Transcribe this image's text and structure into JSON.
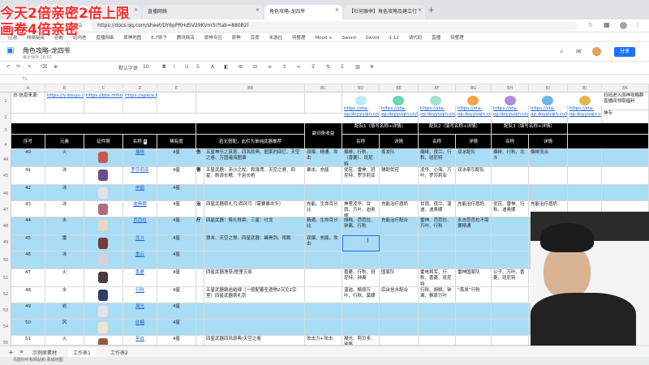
{
  "browser": {
    "tabs": [
      {
        "label": "…gaming",
        "active": false
      },
      {
        "label": "直播网络",
        "active": false
      },
      {
        "label": "角色攻略-龙四爷",
        "active": true
      },
      {
        "label": "【社何猴举】角色攻略及建立行",
        "active": false
      }
    ],
    "url": "https://docs.qq.com/sheet/DY6pPRHdSV29KVm5I?tab=880B2l",
    "bookmarks": [
      "应用",
      "网络链接",
      "谷歌",
      "站内信",
      "直播网络",
      "原神地图",
      "8.7原子",
      "腾讯商店",
      "原神专区",
      "原神",
      "百度",
      "米游社",
      "待整理",
      "Mood ×",
      "Sword",
      "Sword",
      "1.12",
      "请代码",
      "直播",
      "待整理"
    ]
  },
  "header": {
    "doc_title": "角色攻略-龙四爷",
    "doc_sub": "最近保存 16:02",
    "share": "分享"
  },
  "toolbar": {
    "font": "默认字体",
    "size": "10",
    "bold": "B"
  },
  "columns": [
    "A",
    "B",
    "C",
    "D",
    "E",
    "BB",
    "BC",
    "BD",
    "BE",
    "BF",
    "BG",
    "BH",
    "BI",
    "BJ",
    "BK"
  ],
  "rows": [
    "1",
    "2",
    "3",
    "4",
    "44",
    "45",
    "46",
    "47",
    "48",
    "49",
    "50",
    "51",
    "52",
    "53",
    "54",
    "55"
  ],
  "top": {
    "a1": "总-信息来源:",
    "b1": "https://v.douyu.com/author/yBRbxVvvzdZ4",
    "c1": "https://bbs.mihoyo.com/ys/collection/577792",
    "d1": "https://space.bilibili.com/307353814",
    "bd_links": [
      "https://sta-op.doyyuqin.cn/butter",
      "https://sta-op.doyyuqin.cn/butter",
      "https://sta-op.doyyuqin.cn/butter",
      "https://sta-op.doyyuqin.cn/butter",
      "https://sta-op.doyyuqin.cn/butter",
      "https://sta-op.doyyuqin.cn/butter",
      "https://sta-op.doyyuqin.cn/butter"
    ],
    "bk1": "扫码进入原神攻略群直播间领取福利",
    "bk2": "神专"
  },
  "headers": {
    "seq": "序号",
    "element": "元素",
    "portrait": "证件照",
    "name": "名称",
    "rarity": "稀有度",
    "weapon_note": "若无搭配，此栏为单纯武器推荐",
    "sub": "副词条收益",
    "team1": "配队1（填写名称+详情）",
    "team2": "配队2（填写名称+详情）",
    "team3": "配队3（填写名称+详情）",
    "col_name": "名称",
    "col_detail": "详情"
  },
  "rows_data": [
    {
      "row": "44",
      "seq": "40",
      "el": "火",
      "name": "烟绯",
      "rar": "4星",
      "side": "伤",
      "weapon": "五星神乐之真意、四风原典、图莱的回忆、天空之卷、万国诸海图谱",
      "sub": "双爆、精通、攻击",
      "t1n": "烟绯、行秋、（香菱）、班尼特",
      "t1d": "蒸发队",
      "t2n": "烟绯、夜兰、行秋、班尼特",
      "t2d": "双冰配队",
      "t3n": "烟绯、行秋、北斗",
      "t3d": "烟绯流派",
      "color": "blue"
    },
    {
      "row": "45",
      "seq": "41",
      "el": "冰",
      "name": "罗莎莉亚",
      "rar": "4星",
      "side": "害",
      "weapon": "五星武器：赤沙之杖、和璞鸢、天空之脊、四星：断浪长鳍、千岩长枪",
      "sub": "暴击、充能",
      "t1n": "优菈、雷神、班尼特、罗莎莉亚",
      "t1d": "辅助优菈",
      "t2n": "凌华、心海、万叶、罗莎莉亚",
      "t2d": "双冰牵引配队",
      "t3n": "",
      "t3d": "",
      "color": "white"
    },
    {
      "row": "46",
      "seq": "42",
      "el": "冰",
      "name": "申鹤",
      "rar": "4星",
      "side": "",
      "weapon": "",
      "sub": "",
      "t1n": "",
      "t1d": "",
      "t2n": "",
      "t2d": "",
      "t3n": "",
      "t3d": "",
      "color": "blue"
    },
    {
      "row": "47",
      "seq": "43",
      "el": "冰",
      "name": "迪奥娜",
      "rar": "4星",
      "side": "治",
      "weapon": "四星武器祭礼弓/西风弓（需要暴击头）",
      "sub": "充能、生命百分比",
      "t1n": "神里凌华、甘雨、万叶、迪奥娜",
      "t1d": "充能治疗盾奶",
      "t2n": "甘雨、夜兰、温迪、迪奥娜",
      "t2d": "充能治疗盾奶",
      "t3n": "优菈、雷神、行秋、迪奥娜",
      "t3d": "充能治疗盾奶",
      "color": "white"
    },
    {
      "row": "48",
      "seq": "44",
      "el": "水",
      "name": "芭芭拉",
      "rar": "4星",
      "side": "疗",
      "weapon": "四星武器：祭礼残章、三星：讨龙",
      "sub": "精通、生命百分比",
      "t1n": "胡桃、芭芭拉、钟离、行秋",
      "t1d": "充能治疗配合",
      "t2n": "雷神、芭芭拉、万叶、行秋",
      "t2d": "永冻芭芭拉不需要精通",
      "t3n": "",
      "t3d": "",
      "color": "blue"
    },
    {
      "row": "49",
      "seq": "45",
      "el": "雷",
      "name": "北斗",
      "rar": "4星",
      "side": "",
      "weapon": "狼末、天空之脊、四星武器：螭骨剑、雨裁",
      "sub": "双爆、充能、攻击",
      "t1n": "",
      "t1d": "",
      "t2n": "",
      "t2d": "",
      "t3n": "",
      "t3d": "",
      "color": "blue"
    },
    {
      "row": "50",
      "seq": "46",
      "el": "冰",
      "name": "重云",
      "rar": "4星",
      "side": "",
      "weapon": "",
      "sub": "",
      "t1n": "",
      "t1d": "",
      "t2n": "",
      "t2d": "",
      "t3n": "",
      "t3d": "",
      "color": "blue"
    },
    {
      "row": "51",
      "seq": "47",
      "el": "火",
      "name": "香菱",
      "rar": "4星",
      "side": "",
      "weapon": "四星武器渔获/匣里灭辰",
      "sub": "",
      "t1n": "香菱、行秋、班尼特、钟离",
      "t1d": "国家队",
      "t2n": "雷电将军、行秋、香菱、班尼特",
      "t2d": "雷神国家队",
      "t3n": "公子、万叶、香菱、班尼特",
      "t3d": "",
      "color": "white"
    },
    {
      "row": "52",
      "seq": "48",
      "el": "水",
      "name": "行秋",
      "rar": "4星",
      "side": "",
      "weapon": "五星武器磐岩结绿（一般配着圣遗物2沉沦2宗室）四星武器祭礼剑",
      "sub": "",
      "t1n": "温迪、枫原万叶、行秋、莫娜",
      "t1d": "后台挂水配合",
      "t2n": "行秋、胡桃、钟离、枫原万叶",
      "t2d": "“蒸发”行秋",
      "t3n": "",
      "t3d": "",
      "color": "white"
    },
    {
      "row": "53",
      "seq": "49",
      "el": "岩",
      "name": "凝光",
      "rar": "4星",
      "side": "",
      "weapon": "",
      "sub": "",
      "t1n": "",
      "t1d": "",
      "t2n": "",
      "t2d": "",
      "t3n": "",
      "t3d": "",
      "color": "blue"
    },
    {
      "row": "54",
      "seq": "50",
      "el": "风",
      "name": "砂糖",
      "rar": "4星",
      "side": "",
      "weapon": "",
      "sub": "",
      "t1n": "",
      "t1d": "",
      "t2n": "",
      "t2d": "",
      "t3n": "",
      "t3d": "",
      "color": "blue"
    },
    {
      "row": "55",
      "seq": "51",
      "el": "火",
      "name": "辛焱",
      "rar": "4星",
      "side": "",
      "weapon": "四星武器四风原典/天空之卷",
      "sub": "攻击力+攻击",
      "t1n": "凝光、阿贝多、钟离",
      "t1d": "",
      "t2n": "",
      "t2d": "",
      "t3n": "",
      "t3d": "",
      "color": "white"
    }
  ],
  "sheets": {
    "add": "+",
    "source": "示例原素材",
    "tab1": "工作表1",
    "tab2": "工作表2"
  },
  "taskbar": "讯能好听有网站和 慕诚地图",
  "overlay": {
    "line1": "今天2倍亲密2倍上限",
    "line2": "画卷4倍亲密"
  },
  "colors": {
    "accent": "#1e6fff",
    "row_blue": "#a9dcf5",
    "overlay_red": "#ff2a2a",
    "header_black": "#000000"
  }
}
